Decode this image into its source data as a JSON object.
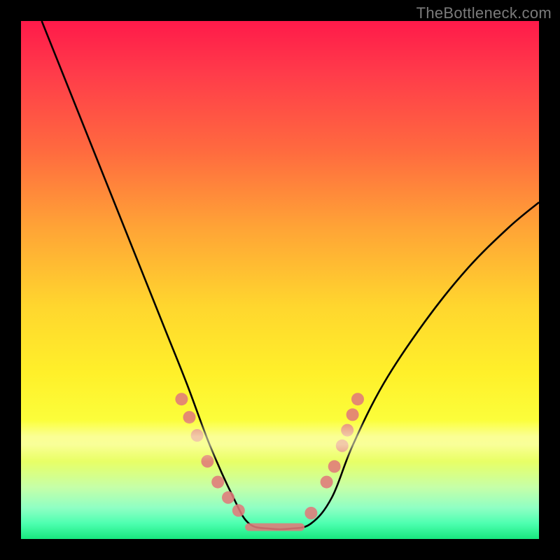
{
  "watermark": "TheBottleneck.com",
  "chart_data": {
    "type": "line",
    "title": "",
    "xlabel": "",
    "ylabel": "",
    "xlim": [
      0,
      100
    ],
    "ylim": [
      0,
      100
    ],
    "background_gradient": [
      "#ff1a4a",
      "#ffd62e",
      "#18e87e"
    ],
    "series": [
      {
        "name": "bottleneck-curve",
        "x": [
          4,
          8,
          12,
          16,
          20,
          24,
          28,
          32,
          36.5,
          41,
          44,
          48,
          52,
          56,
          60,
          64,
          70,
          78,
          86,
          94,
          100
        ],
        "y": [
          100,
          90,
          80,
          70,
          60,
          50,
          40,
          30,
          18,
          8,
          3,
          2,
          2,
          3,
          8,
          18,
          30,
          42,
          52,
          60,
          65
        ]
      }
    ],
    "markers": {
      "name": "highlight-dots",
      "color": "#e07a7a",
      "left_cluster": [
        [
          31,
          27
        ],
        [
          32.5,
          23.5
        ],
        [
          34,
          20
        ],
        [
          36,
          15
        ],
        [
          38,
          11
        ],
        [
          40,
          8
        ],
        [
          42,
          5.5
        ]
      ],
      "right_cluster": [
        [
          56,
          5
        ],
        [
          59,
          11
        ],
        [
          60.5,
          14
        ],
        [
          62,
          18
        ],
        [
          63,
          21
        ],
        [
          64,
          24
        ],
        [
          65,
          27
        ]
      ],
      "flat_segment": {
        "x0": 44,
        "x1": 54,
        "y": 2.3
      }
    }
  }
}
